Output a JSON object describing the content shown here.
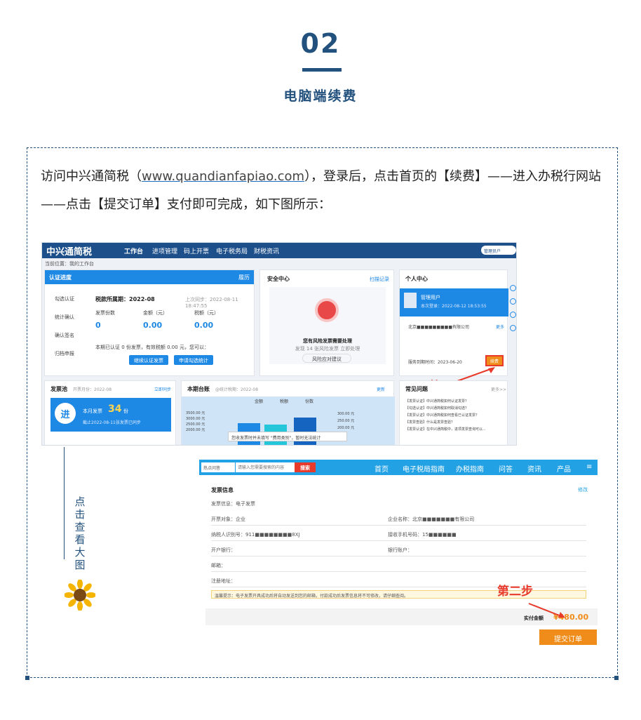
{
  "header": {
    "number": "02",
    "subtitle": "电脑端续费"
  },
  "intro": {
    "part1": "访问中兴通简税（",
    "url": "www.quandianfapiao.com",
    "part2": "），登录后，点击首页的【续费】——进入办税行网站——点击【提交订单】支付即可完成，如下图所示："
  },
  "side_label": "点击查看大图",
  "s1": {
    "logo": "中兴通简税",
    "nav": [
      "工作台",
      "进项管理",
      "码上开票",
      "电子税务局",
      "财税资讯"
    ],
    "admin": "管理员户",
    "crumb": "当前位置：我的工作台",
    "auth": {
      "title": "认证进度",
      "history": "履历",
      "steps": [
        "勾选认证",
        "统计确认",
        "确认签名",
        "归档申报"
      ],
      "period_label": "税款所属期：2022-08",
      "sync": "上次同步：2022-08-11 18:47:55",
      "cols": [
        "发票份数",
        "金额（元）",
        "税额（元）"
      ],
      "vals": [
        "0",
        "0.00",
        "0.00"
      ],
      "note": "本期已认证 0 份发票，有效税额 0.00 元，您可以：",
      "btn1": "继续认证发票",
      "btn2": "申请勾选统计"
    },
    "security": {
      "title": "安全中心",
      "link": "扫描记录",
      "msg": "您有风险发票需要处理",
      "sub": "发现 14 张风险发票  立即处理",
      "btn": "风险应对建议"
    },
    "personal": {
      "title": "个人中心",
      "user": "管理用户",
      "last": "本次登录：2022-08-12 18:53:55",
      "company": "北京■■■■■■■■■有限公司",
      "renew_date": "服务到期时间：2023-06-20",
      "renew_btn": "续费",
      "more": "更多"
    },
    "step1": "第一步",
    "invoice": {
      "title": "发票池",
      "period": "开票月份：2022-08",
      "sync": "立即同步",
      "enter": "进",
      "month_label": "本月发票",
      "count": "34",
      "unit": "份",
      "sync_note": "截止2022-08-11张发票已同步"
    },
    "chart": {
      "title": "本期台账",
      "period": "@统计税期：2022-08",
      "legend": [
        "金额",
        "税额",
        "份数"
      ],
      "y": [
        "3500.00 元",
        "3000.00 元",
        "2500.00 元",
        "2000.00 元"
      ],
      "y2": [
        "300.00 元",
        "250.00 元",
        "200.00 元"
      ],
      "tip": "您收发票时并未填写 \"费用类别\"，暂时无法统计",
      "more": "更新"
    },
    "faq": {
      "title": "常见问题",
      "more": "更多>>",
      "items": [
        "【发票认证】中兴通简税如何认证发票？",
        "【勾选认证】中兴通简税如何取消勾选？",
        "【发票认证】中兴通简税如何查看已认证发票？",
        "【发票查验】什么是发票查验？",
        "【发票认证】在中兴通简税中，进项发票查询可以..."
      ]
    }
  },
  "s2": {
    "search_placeholder": "请输入您需要搜索的内容",
    "search_select": "热点问答",
    "search_btn": "搜索",
    "nav": [
      "首页",
      "电子税局指南",
      "办税指南",
      "问答",
      "资讯",
      "产品",
      "≡"
    ],
    "section": "发票信息",
    "edit": "修改",
    "type": "发票信息：电子发票",
    "rows": [
      [
        "开票对象：企业",
        "企业名称：北京■■■■■■■有限公司"
      ],
      [
        "纳税人识别号：911■■■■■■■■8XJ",
        "接收手机号码：15■■■■■■"
      ],
      [
        "开户银行：",
        "银行账户："
      ],
      [
        "邮箱：",
        ""
      ],
      [
        "注册地址：",
        ""
      ]
    ],
    "tip": "温馨提示：电子发票开具成功后将自动发送到您的邮箱，付款成功后发票信息将不可修改，请仔细查阅。",
    "amount_label": "实付金额",
    "amount": "¥480.00",
    "submit": "提交订单",
    "step2": "第二步"
  }
}
